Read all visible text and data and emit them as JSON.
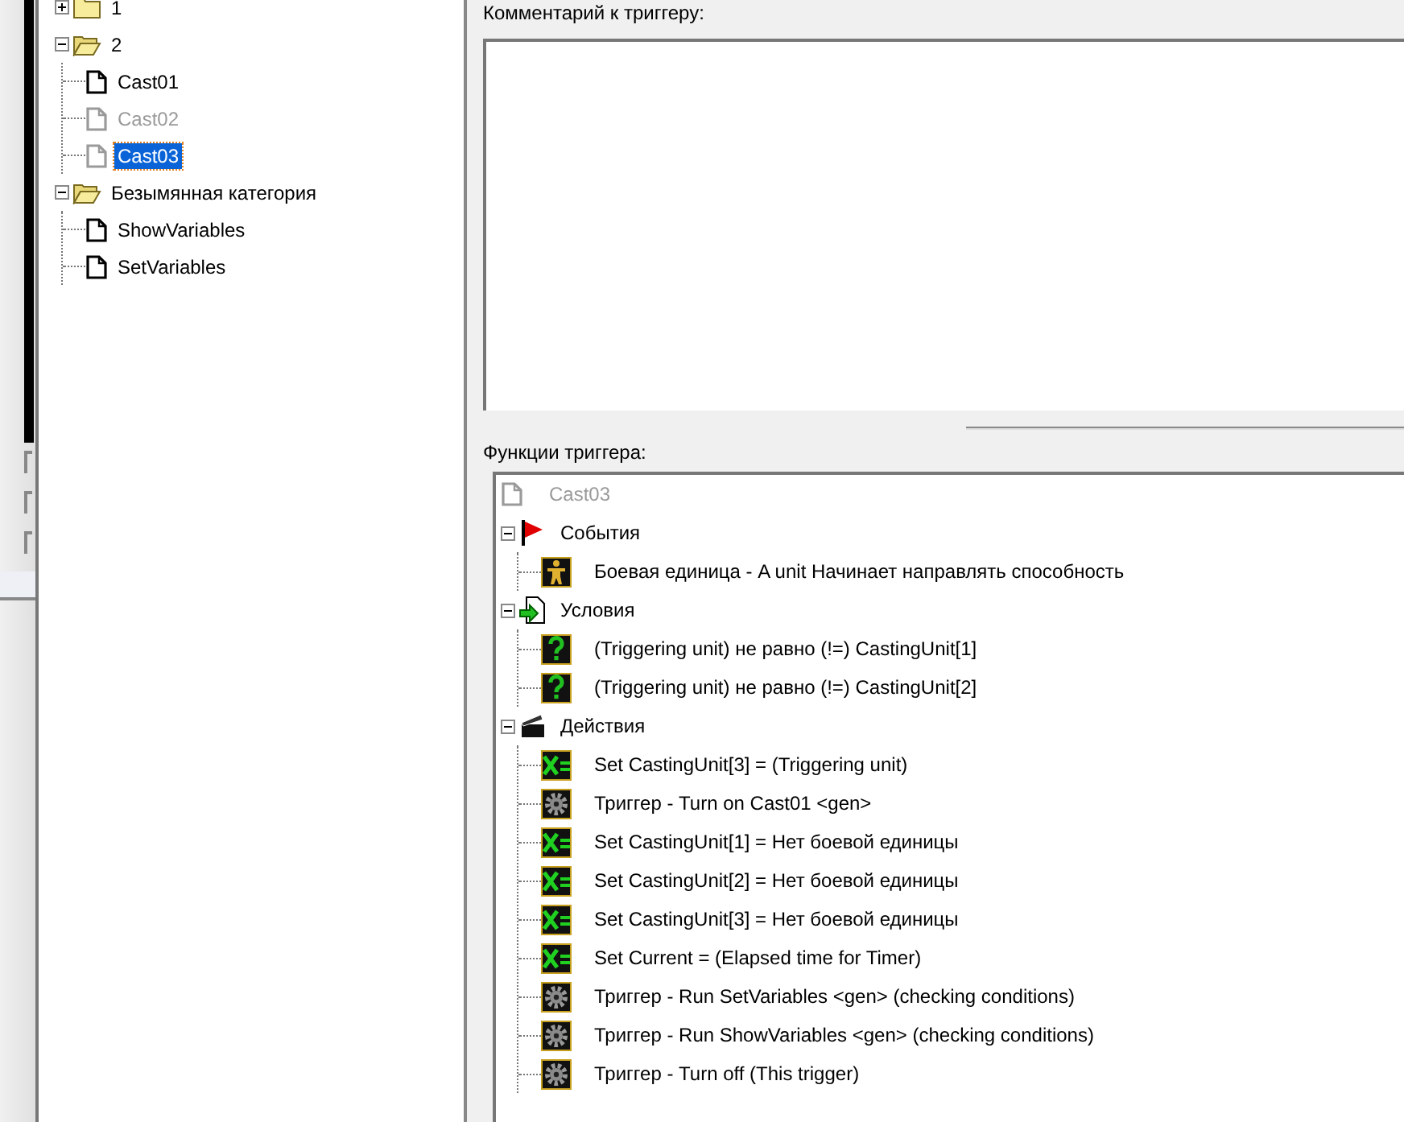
{
  "left_tree": {
    "nodes": [
      {
        "kind": "folder",
        "label": "1",
        "expanded": false,
        "selected": false
      },
      {
        "kind": "folder",
        "label": "2",
        "expanded": true,
        "selected": false,
        "children": [
          {
            "kind": "trigger",
            "label": "Cast01",
            "disabled": false,
            "selected": false
          },
          {
            "kind": "trigger",
            "label": "Cast02",
            "disabled": true,
            "selected": false
          },
          {
            "kind": "trigger",
            "label": "Cast03",
            "disabled": true,
            "selected": true
          }
        ]
      },
      {
        "kind": "folder",
        "label": "Безымянная категория",
        "expanded": true,
        "selected": false,
        "children": [
          {
            "kind": "trigger",
            "label": "ShowVariables",
            "disabled": false,
            "selected": false
          },
          {
            "kind": "trigger",
            "label": "SetVariables",
            "disabled": false,
            "selected": false
          }
        ]
      }
    ]
  },
  "comment": {
    "label": "Комментарий к триггеру:"
  },
  "functions": {
    "label": "Функции триггера:",
    "root": {
      "label": "Cast03",
      "disabled": true
    },
    "sections": [
      {
        "kind": "events",
        "label": "События",
        "expanded": true,
        "items": [
          {
            "kind": "unit",
            "label": "Боевая единица - A unit Начинает направлять способность"
          }
        ]
      },
      {
        "kind": "conditions",
        "label": "Условия",
        "expanded": true,
        "items": [
          {
            "kind": "condition",
            "label": "(Triggering unit) не равно (!=) CastingUnit[1]"
          },
          {
            "kind": "condition",
            "label": "(Triggering unit) не равно (!=) CastingUnit[2]"
          }
        ]
      },
      {
        "kind": "actions",
        "label": "Действия",
        "expanded": true,
        "items": [
          {
            "kind": "set",
            "label": "Set CastingUnit[3] = (Triggering unit)"
          },
          {
            "kind": "trigger",
            "label": "Триггер - Turn on Cast01 <gen>"
          },
          {
            "kind": "set",
            "label": "Set CastingUnit[1] = Нет боевой единицы"
          },
          {
            "kind": "set",
            "label": "Set CastingUnit[2] = Нет боевой единицы"
          },
          {
            "kind": "set",
            "label": "Set CastingUnit[3] = Нет боевой единицы"
          },
          {
            "kind": "set",
            "label": "Set Current = (Elapsed time for Timer)"
          },
          {
            "kind": "trigger",
            "label": "Триггер - Run SetVariables <gen> (checking conditions)"
          },
          {
            "kind": "trigger",
            "label": "Триггер - Run ShowVariables <gen> (checking conditions)"
          },
          {
            "kind": "trigger",
            "label": "Триггер - Turn off (This trigger)"
          }
        ]
      }
    ]
  }
}
